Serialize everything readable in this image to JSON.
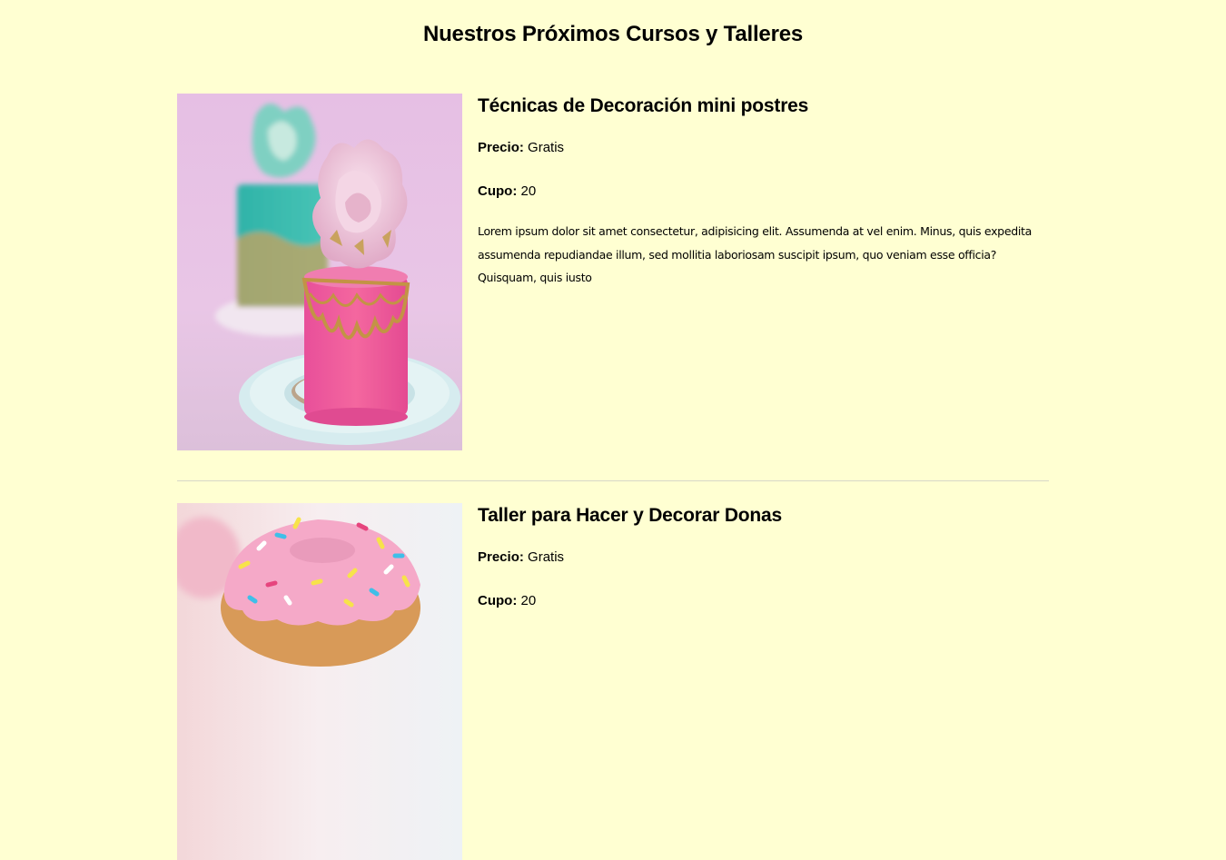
{
  "page": {
    "title": "Nuestros Próximos Cursos y Talleres"
  },
  "courses": [
    {
      "title": "Técnicas de Decoración mini postres",
      "price_label": "Precio:",
      "price_value": "Gratis",
      "cupo_label": "Cupo:",
      "cupo_value": "20",
      "description": "Lorem ipsum dolor sit amet consectetur, adipisicing elit. Assumenda at vel enim. Minus, quis expedita assumenda repudiandae illum, sed mollitia laboriosam suscipit ipsum, quo veniam esse officia? Quisquam, quis iusto",
      "image_icon": "mini-cakes-photo"
    },
    {
      "title": "Taller para Hacer y Decorar Donas",
      "price_label": "Precio:",
      "price_value": "Gratis",
      "cupo_label": "Cupo:",
      "cupo_value": "20",
      "image_icon": "donut-photo"
    }
  ],
  "colors": {
    "background": "#ffffd2",
    "divider": "#d8d8c8"
  }
}
